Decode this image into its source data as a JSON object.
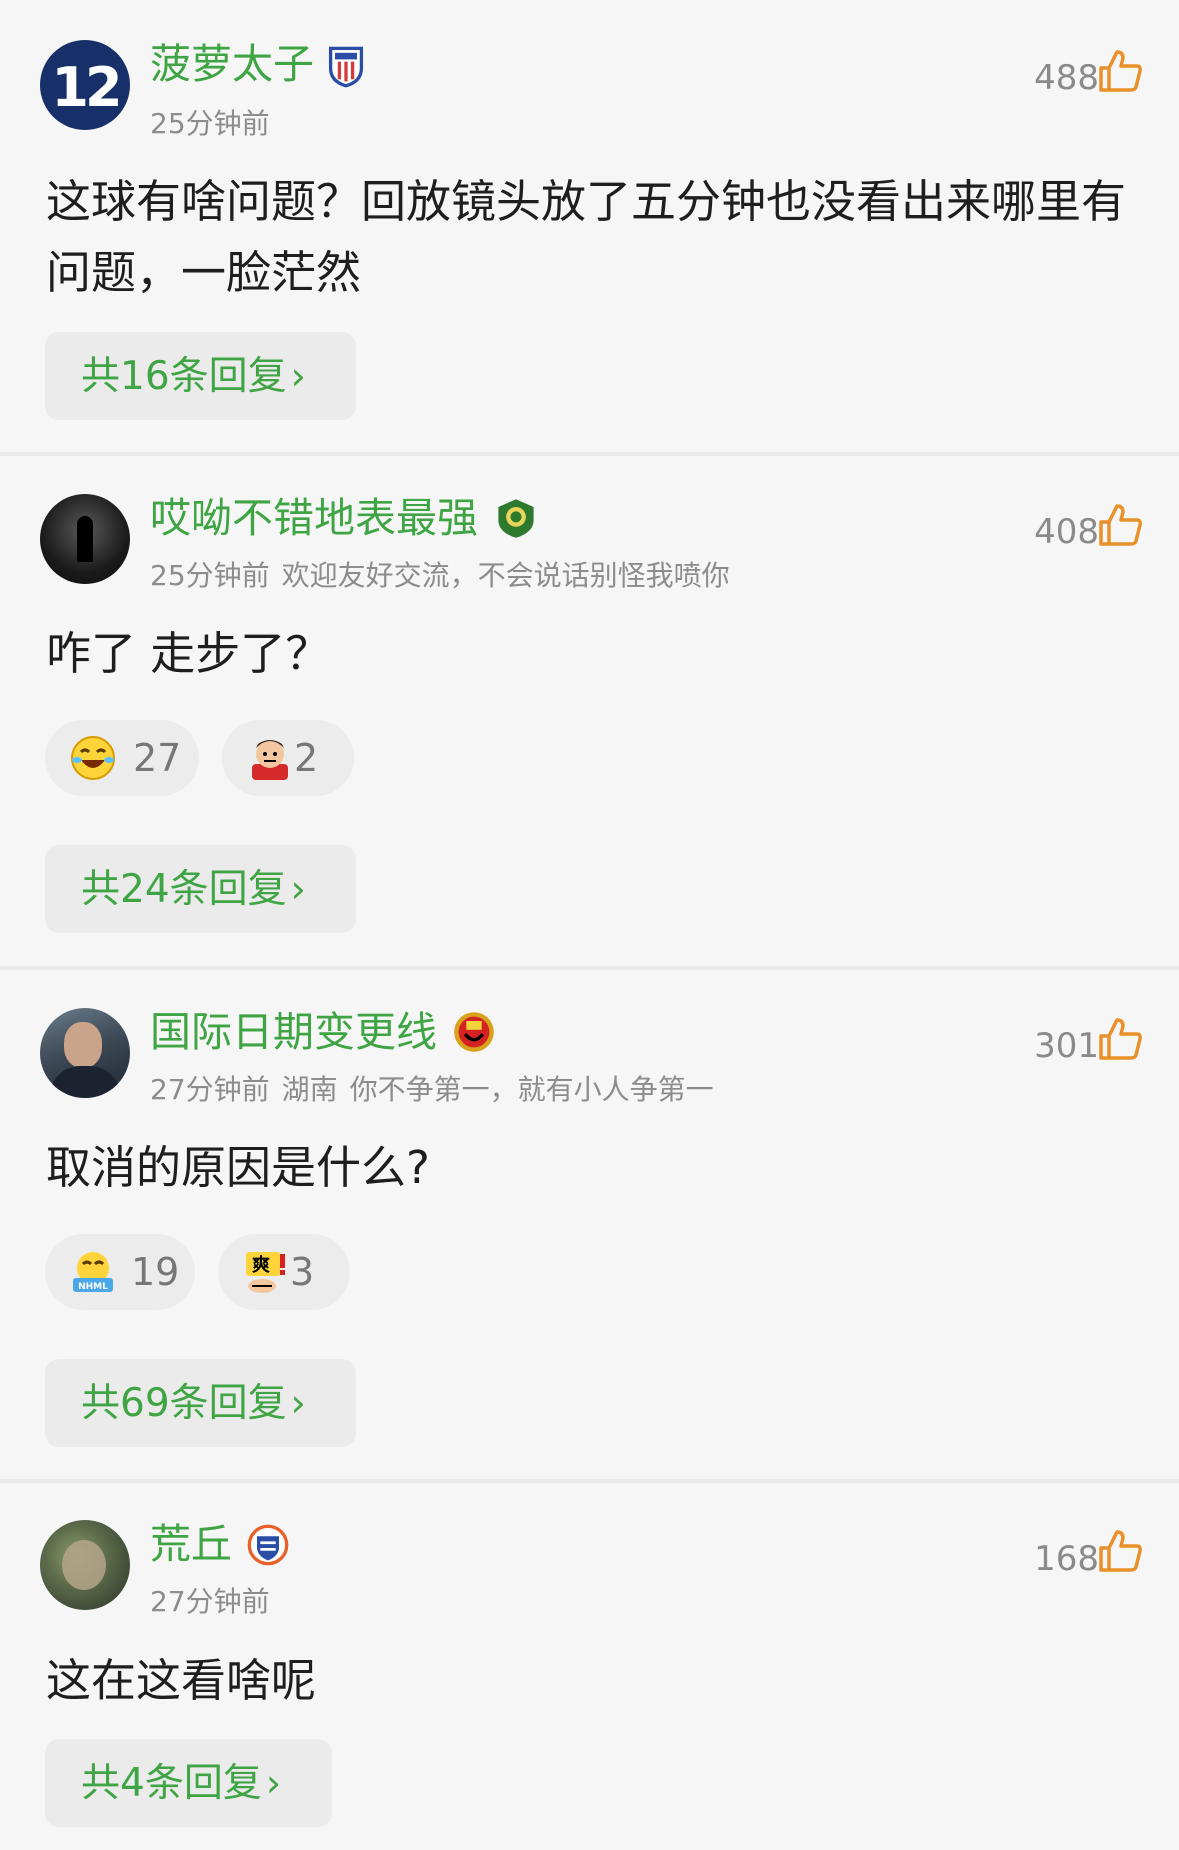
{
  "colors": {
    "accent_green": "#3fa544",
    "like_orange": "#e8902a",
    "background": "#f6f6f6"
  },
  "comments": [
    {
      "username": "菠萝太子",
      "badge_icon": "shenhua-team-badge-icon",
      "time": "25分钟前",
      "location": "",
      "signature": "",
      "likes": "488",
      "text": "这球有啥问题？回放镜头放了五分钟也没看出来哪里有问题，一脸茫然",
      "reactions": [],
      "reply_label": "共16条回复"
    },
    {
      "username": "哎呦不错地表最强",
      "badge_icon": "guoan-team-badge-icon",
      "time": "25分钟前",
      "location": "",
      "signature": "欢迎友好交流，不会说话别怪我喷你",
      "likes": "408",
      "text": "咋了 走步了？",
      "reactions": [
        {
          "icon": "laughing-tears-emoji-icon",
          "count": "27"
        },
        {
          "icon": "red-cartoon-face-emoji-icon",
          "count": "2"
        }
      ],
      "reply_label": "共24条回复"
    },
    {
      "username": "国际日期变更线",
      "badge_icon": "manchester-united-badge-icon",
      "time": "27分钟前",
      "location": "湖南",
      "signature": "你不争第一，就有小人争第一",
      "likes": "301",
      "text": "取消的原因是什么?",
      "reactions": [
        {
          "icon": "nhml-crying-emoji-icon",
          "count": "19"
        },
        {
          "icon": "shuang-emoji-icon",
          "count": "3"
        }
      ],
      "reply_label": "共69条回复"
    },
    {
      "username": "荒丘",
      "badge_icon": "team-shield-badge-icon",
      "time": "27分钟前",
      "location": "",
      "signature": "",
      "likes": "168",
      "text": "这在这看啥呢",
      "reactions": [],
      "reply_label": "共4条回复"
    }
  ],
  "avatar1_text": "12",
  "chevron": "›"
}
